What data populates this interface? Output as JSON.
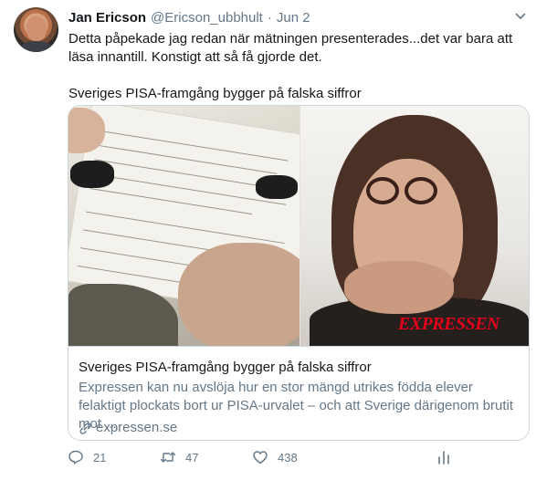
{
  "tweet": {
    "author_name": "Jan Ericson",
    "author_handle": "@Ericson_ubbhult",
    "separator": "·",
    "date": "Jun 2",
    "text_line1": "Detta påpekade jag redan när mätningen presenterades...det var bara att",
    "text_line2": "läsa innantill. Konstigt att så få gjorde det.",
    "text_line3": "Sveriges PISA-framgång bygger på falska siffror"
  },
  "card": {
    "title": "Sveriges PISA-framgång bygger på falska siffror",
    "description": "Expressen kan nu avslöja hur en stor mängd utrikes födda elever felaktigt plockats bort ur PISA-urvalet – och att Sverige därigenom brutit mot ...",
    "domain": "expressen.se",
    "image_logo": "EXPRESSEN"
  },
  "actions": {
    "reply_count": "21",
    "retweet_count": "47",
    "like_count": "438",
    "analytics_icon": "analytics-icon"
  },
  "colors": {
    "text": "#14171a",
    "secondary": "#657786",
    "border": "#ccd6dd",
    "logo_red": "#e2001a"
  }
}
